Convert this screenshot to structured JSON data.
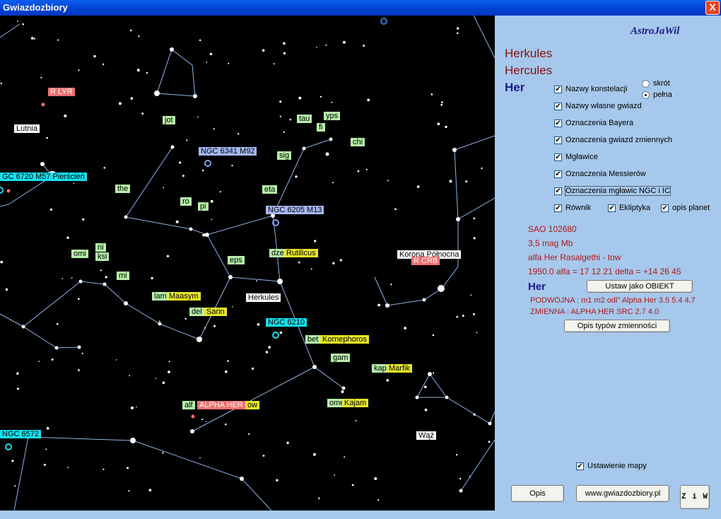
{
  "window": {
    "title": "Gwiazdozbiory",
    "close_glyph": "X"
  },
  "map": {
    "labels": [
      {
        "text": "R LYR",
        "style": "red"
      },
      {
        "text": "Lutnia",
        "style": "wht"
      },
      {
        "text": "GC 6720 M57 Pierścień",
        "style": "cyn"
      },
      {
        "text": "jot",
        "style": "grn"
      },
      {
        "text": "tau",
        "style": "grn"
      },
      {
        "text": "yps",
        "style": "grn"
      },
      {
        "text": "fi",
        "style": "grn"
      },
      {
        "text": "chi",
        "style": "grn"
      },
      {
        "text": "NGC 6341 M92",
        "style": "blu"
      },
      {
        "text": "sig",
        "style": "grn"
      },
      {
        "text": "the",
        "style": "grn"
      },
      {
        "text": "eta",
        "style": "grn"
      },
      {
        "text": "ro",
        "style": "grn"
      },
      {
        "text": "pi",
        "style": "grn"
      },
      {
        "text": "NGC 6205 M13",
        "style": "blu"
      },
      {
        "text": "ni",
        "style": "grn"
      },
      {
        "text": "ksi",
        "style": "grn"
      },
      {
        "text": "omi",
        "style": "grn"
      },
      {
        "text": "dze",
        "style": "grn"
      },
      {
        "text": "Rutilicus",
        "style": "yel"
      },
      {
        "text": "Korona Północna",
        "style": "wht"
      },
      {
        "text": "R CRB",
        "style": "red"
      },
      {
        "text": "eps",
        "style": "grn"
      },
      {
        "text": "mi",
        "style": "grn"
      },
      {
        "text": "lam",
        "style": "grn"
      },
      {
        "text": "Maasym",
        "style": "yel"
      },
      {
        "text": "Herkules",
        "style": "wht"
      },
      {
        "text": "del",
        "style": "grn"
      },
      {
        "text": "Sarin",
        "style": "yel"
      },
      {
        "text": "NGC 6210",
        "style": "cyn"
      },
      {
        "text": "bet",
        "style": "grn"
      },
      {
        "text": "Kornephoros",
        "style": "yel"
      },
      {
        "text": "gam",
        "style": "grn"
      },
      {
        "text": "kap",
        "style": "grn"
      },
      {
        "text": "Marfik",
        "style": "yel"
      },
      {
        "text": "ome",
        "style": "grn"
      },
      {
        "text": "Kajam",
        "style": "yel"
      },
      {
        "text": "alf",
        "style": "grn"
      },
      {
        "text": "ALPHA HER",
        "style": "red"
      },
      {
        "text": "ow",
        "style": "yel"
      },
      {
        "text": "NGC 6572",
        "style": "cyn"
      },
      {
        "text": "Wąż",
        "style": "wht"
      }
    ]
  },
  "panel": {
    "brand": "AstroJaWil",
    "name_pl": "Herkules",
    "name_lat": "Hercules",
    "abbrev": "Her",
    "radio": [
      {
        "label": "skrót",
        "checked": false
      },
      {
        "label": "pełna",
        "checked": true
      }
    ],
    "checkboxes": [
      {
        "label": "Nazwy konstelacji",
        "checked": true
      },
      {
        "label": "Nazwy własne gwiazd",
        "checked": true
      },
      {
        "label": "Oznaczenia Bayera",
        "checked": true
      },
      {
        "label": "Oznaczenia gwiazd zmiennych",
        "checked": true
      },
      {
        "label": "Mgławice",
        "checked": true
      },
      {
        "label": "Oznaczenia Messierów",
        "checked": true
      },
      {
        "label": "Oznaczenia mgławic NGC i IC",
        "checked": true
      }
    ],
    "row_checks": [
      {
        "label": "Równik",
        "checked": true
      },
      {
        "label": "Ekliptyka",
        "checked": true
      },
      {
        "label": "opis planet",
        "checked": true
      }
    ],
    "star": {
      "sao": "SAO 102680",
      "mag": "3,5 mag  Mb",
      "name": "alfa Her  Rasalgethi - tow",
      "coords": "1950.0  alfa = 17 12 21   delta = +14 26 45",
      "abbrev": "Her",
      "double": "PODWÓJNA : m1 m2 odl\"  Alpha Her  3.5 5.4 4.7",
      "variable": "ZMIENNA :  ALPHA HER   SRC     2.7  4.0"
    },
    "buttons": {
      "set_object": "Ustaw jako OBIEKT",
      "variability": "Opis typów zmienności",
      "opis": "Opis",
      "website": "www.gwiazdozbiory.pl",
      "ziw": "Z i W"
    },
    "map_setting": {
      "label": "Ustawienie mapy",
      "checked": true
    },
    "check_glyph": "✔"
  },
  "colors": {
    "label_green": "#b6f0a8",
    "label_yellow": "#e8e82a",
    "label_cyan": "#15e0ee",
    "label_blue": "#a6b8f4",
    "label_red": "#f07070",
    "panel_bg": "#a6c8ec",
    "brand": "#1a1a8a"
  }
}
